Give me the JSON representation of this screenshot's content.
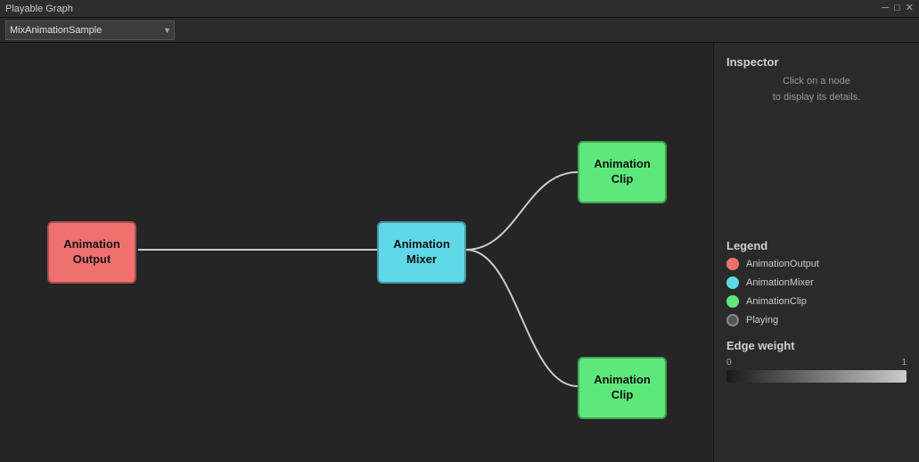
{
  "titlebar": {
    "title": "Playable Graph",
    "minimize": "─",
    "maximize": "□",
    "close": "✕"
  },
  "dropdown": {
    "selected": "MixAnimationSample",
    "options": [
      "MixAnimationSample"
    ]
  },
  "inspector": {
    "title": "Inspector",
    "desc_line1": "Click on a node",
    "desc_line2": "to display its details."
  },
  "legend": {
    "title": "Legend",
    "items": [
      {
        "label": "AnimationOutput",
        "color": "#f07070"
      },
      {
        "label": "AnimationMixer",
        "color": "#60d8e8"
      },
      {
        "label": "AnimationClip",
        "color": "#5ee87a"
      },
      {
        "label": "Playing",
        "color": "playing"
      }
    ]
  },
  "edge_weight": {
    "title": "Edge weight",
    "min": "0",
    "max": "1"
  },
  "nodes": {
    "animation_output": {
      "label_line1": "Animation",
      "label_line2": "Output",
      "color": "#f07070"
    },
    "animation_mixer": {
      "label_line1": "Animation",
      "label_line2": "Mixer",
      "color": "#60d8e8"
    },
    "animation_clip_top": {
      "label_line1": "Animation",
      "label_line2": "Clip",
      "color": "#5ee87a"
    },
    "animation_clip_bottom": {
      "label_line1": "Animation",
      "label_line2": "Clip",
      "color": "#5ee87a"
    }
  }
}
